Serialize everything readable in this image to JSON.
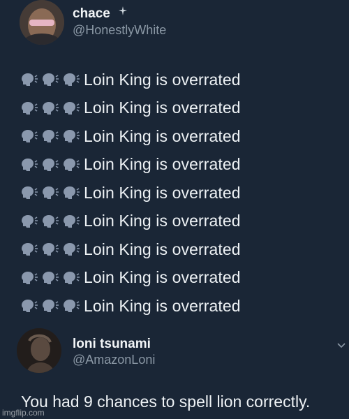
{
  "tweet1": {
    "display_name": "chace",
    "handle": "@HonestlyWhite",
    "lines": [
      "Loin King is overrated",
      "Loin King is overrated",
      "Loin King is overrated",
      "Loin King is overrated",
      "Loin King is overrated",
      "Loin King is overrated",
      "Loin King is overrated",
      "Loin King is overrated",
      "Loin King is overrated"
    ],
    "emoji_icon": "speaking-head-icon"
  },
  "tweet2": {
    "display_name": "loni tsunami",
    "handle": "@AmazonLoni",
    "text": "You had 9 chances to spell lion correctly.",
    "menu_icon": "chevron-down-icon"
  },
  "watermark": "imgflip.com",
  "colors": {
    "background": "#1a2636",
    "text": "#eef2f5",
    "secondary_text": "#8b98a5",
    "emoji": "#8a98ad"
  }
}
